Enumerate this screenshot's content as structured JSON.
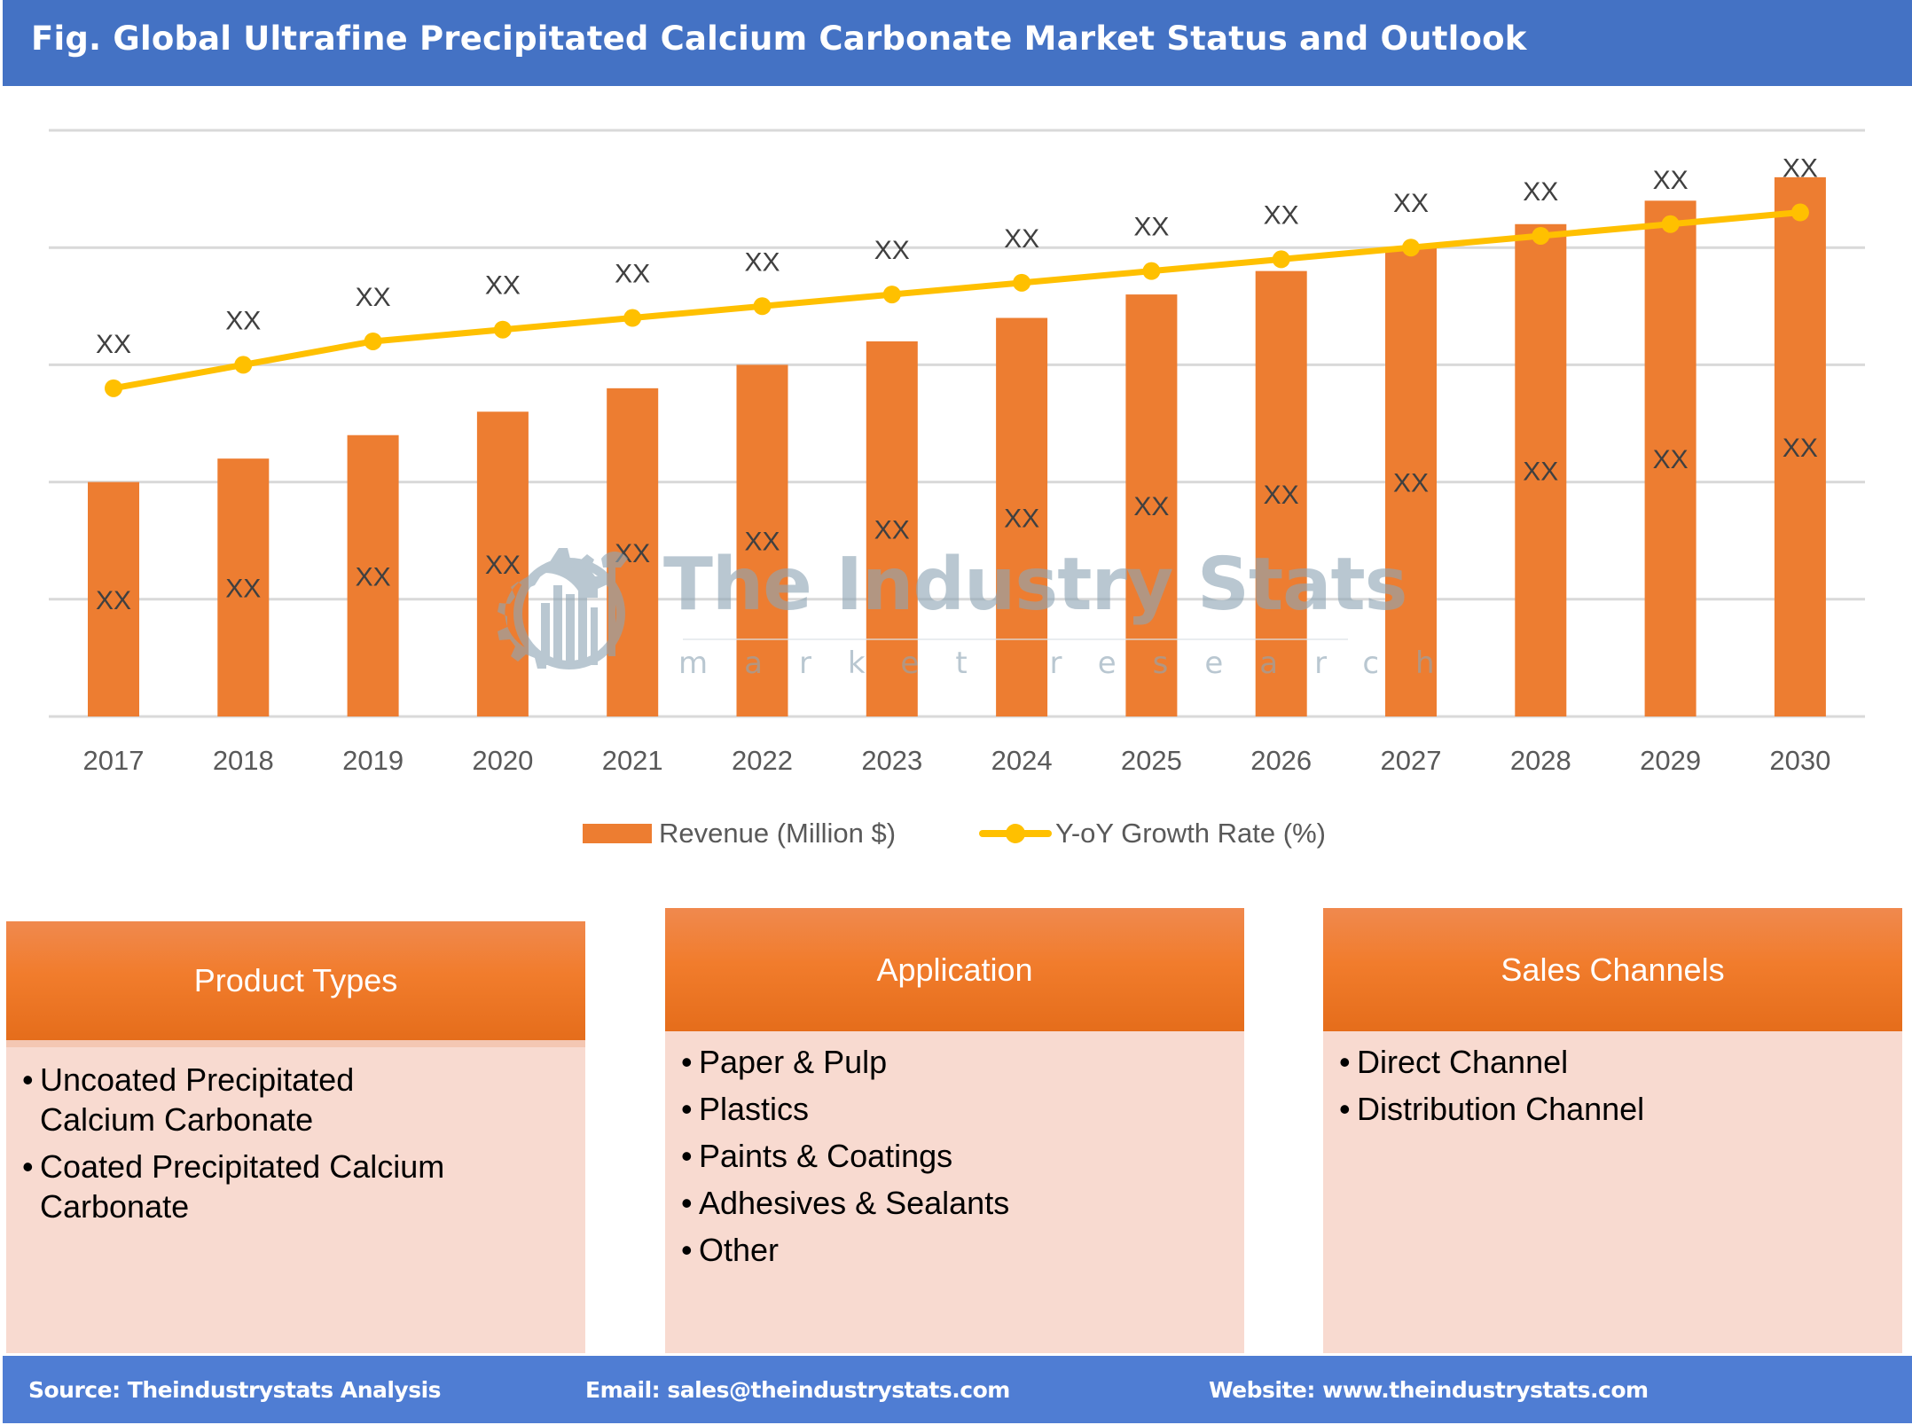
{
  "header": {
    "title": "Fig. Global Ultrafine Precipitated Calcium Carbonate Market Status and Outlook",
    "background_color": "#4472c4"
  },
  "chart_data": {
    "type": "bar",
    "title": "Fig. Global Ultrafine Precipitated Calcium Carbonate Market Status and Outlook",
    "xlabel": "",
    "ylabel": "",
    "categories": [
      "2017",
      "2018",
      "2019",
      "2020",
      "2021",
      "2022",
      "2023",
      "2024",
      "2025",
      "2026",
      "2027",
      "2028",
      "2029",
      "2030"
    ],
    "ylim": [
      0,
      5
    ],
    "y_tick_labels_shown": false,
    "grid": true,
    "gridlines": 5,
    "legend_position": "bottom",
    "note": "Values are relative estimates read from mark positions against unlabeled gridlines (0-5 gridline units); all data labels display the placeholder text 'XX'.",
    "series": [
      {
        "name": "Revenue (Million $)",
        "type": "bar",
        "color": "#ed7d31",
        "values": [
          2.0,
          2.2,
          2.4,
          2.6,
          2.8,
          3.0,
          3.2,
          3.4,
          3.6,
          3.8,
          4.0,
          4.2,
          4.4,
          4.6
        ],
        "data_labels": [
          "XX",
          "XX",
          "XX",
          "XX",
          "XX",
          "XX",
          "XX",
          "XX",
          "XX",
          "XX",
          "XX",
          "XX",
          "XX",
          "XX"
        ],
        "label_position": "center"
      },
      {
        "name": "Y-oY Growth Rate (%)",
        "type": "line",
        "color": "#ffc000",
        "marker": "circle",
        "values": [
          2.8,
          3.0,
          3.2,
          3.3,
          3.4,
          3.5,
          3.6,
          3.7,
          3.8,
          3.9,
          4.0,
          4.1,
          4.2,
          4.3
        ],
        "data_labels": [
          "XX",
          "XX",
          "XX",
          "XX",
          "XX",
          "XX",
          "XX",
          "XX",
          "XX",
          "XX",
          "XX",
          "XX",
          "XX",
          "XX"
        ],
        "label_position": "above"
      }
    ],
    "legend": [
      {
        "label": "Revenue (Million $)",
        "marker": "bar-swatch",
        "color": "#ed7d31"
      },
      {
        "label": "Y-oY Growth Rate (%)",
        "marker": "line-with-circle",
        "color": "#ffc000"
      }
    ]
  },
  "watermark": {
    "icon": "gear-chart-wrench-logo-icon",
    "title": "The Industry Stats",
    "subtitle": "market research"
  },
  "panels": [
    {
      "title": "Product Types",
      "items": [
        "Uncoated Precipitated Calcium Carbonate",
        "Coated Precipitated Calcium Carbonate"
      ]
    },
    {
      "title": "Application",
      "items": [
        "Paper & Pulp",
        "Plastics",
        "Paints & Coatings",
        "Adhesives & Sealants",
        "Other"
      ]
    },
    {
      "title": "Sales Channels",
      "items": [
        "Direct Channel",
        "Distribution Channel"
      ]
    }
  ],
  "bullet_glyph": "•",
  "footer": {
    "source": "Source: Theindustrystats Analysis",
    "email": "Email: sales@theindustrystats.com",
    "website": "Website: www.theindustrystats.com",
    "background_color": "#4f7dd3"
  }
}
